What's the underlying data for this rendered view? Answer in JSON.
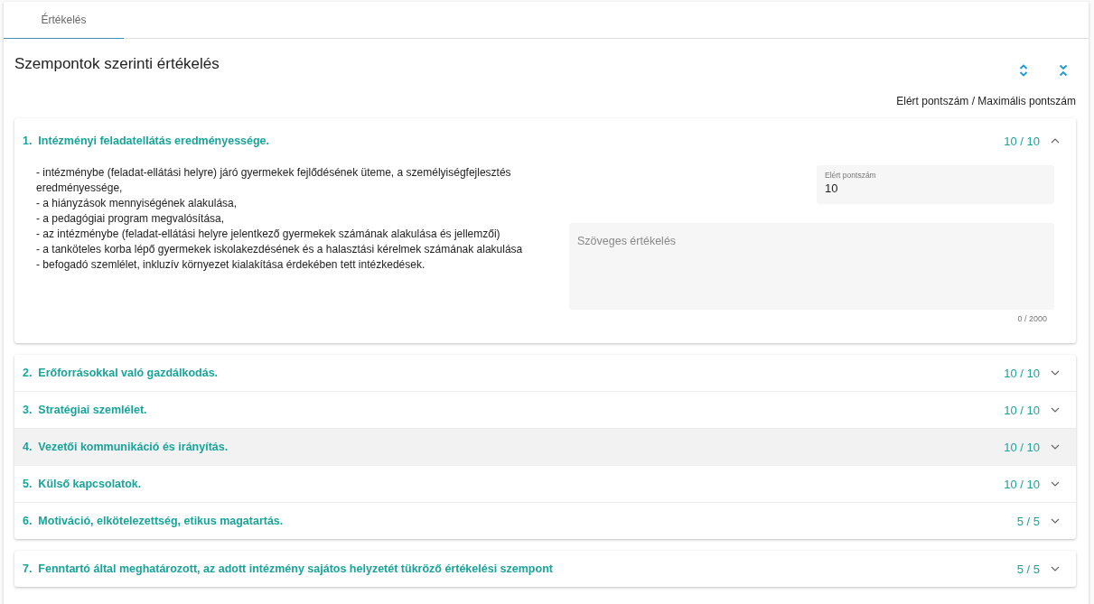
{
  "tabs": [
    {
      "label": "Értékelés",
      "selected": true
    }
  ],
  "title": "Szempontok szerinti értékelés",
  "column_caption": "Elért pontszám / Maximális pontszám",
  "panel_groups": [
    [
      {
        "title": "1.  Intézményi feladatellátás eredményessége.",
        "score": "10 / 10",
        "expanded": true,
        "highlighted": false,
        "description": [
          "- intézménybe (feladat-ellátási helyre) járó gyermekek fejlődésének üteme, a személyiségfejlesztés eredményessége,",
          "- a hiányzások mennyiségének alakulása,",
          "- a pedagógiai program megvalósítása,",
          "- az intézménybe (feladat-ellátási helyre jelentkező gyermekek számának alakulása és jellemzői)",
          "- a tanköteles korba lépő gyermekek iskolakezdésének és a halasztási kérelmek számának alakulása",
          "- befogadó szemlélet, inkluzív környezet kialakítása érdekében tett intézkedések."
        ],
        "score_field": {
          "label": "Elért pontszám",
          "value": "10"
        },
        "text_field": {
          "placeholder": "Szöveges értékelés",
          "counter": "0 / 2000"
        }
      }
    ],
    [
      {
        "title": "2.  Erőforrásokkal való gazdálkodás.",
        "score": "10 / 10",
        "expanded": false,
        "highlighted": false
      },
      {
        "title": "3.  Stratégiai szemlélet.",
        "score": "10 / 10",
        "expanded": false,
        "highlighted": false
      },
      {
        "title": "4.  Vezetői kommunikáció és irányítás.",
        "score": "10 / 10",
        "expanded": false,
        "highlighted": true
      },
      {
        "title": "5.  Külső kapcsolatok.",
        "score": "10 / 10",
        "expanded": false,
        "highlighted": false
      },
      {
        "title": "6.  Motiváció, elkötelezettség, etikus magatartás.",
        "score": "5 / 5",
        "expanded": false,
        "highlighted": false
      }
    ],
    [
      {
        "title": "7.  Fenntartó által meghatározott, az adott intézmény sajátos helyzetét tükröző értékelési szempont",
        "score": "5 / 5",
        "expanded": false,
        "highlighted": false
      }
    ]
  ]
}
